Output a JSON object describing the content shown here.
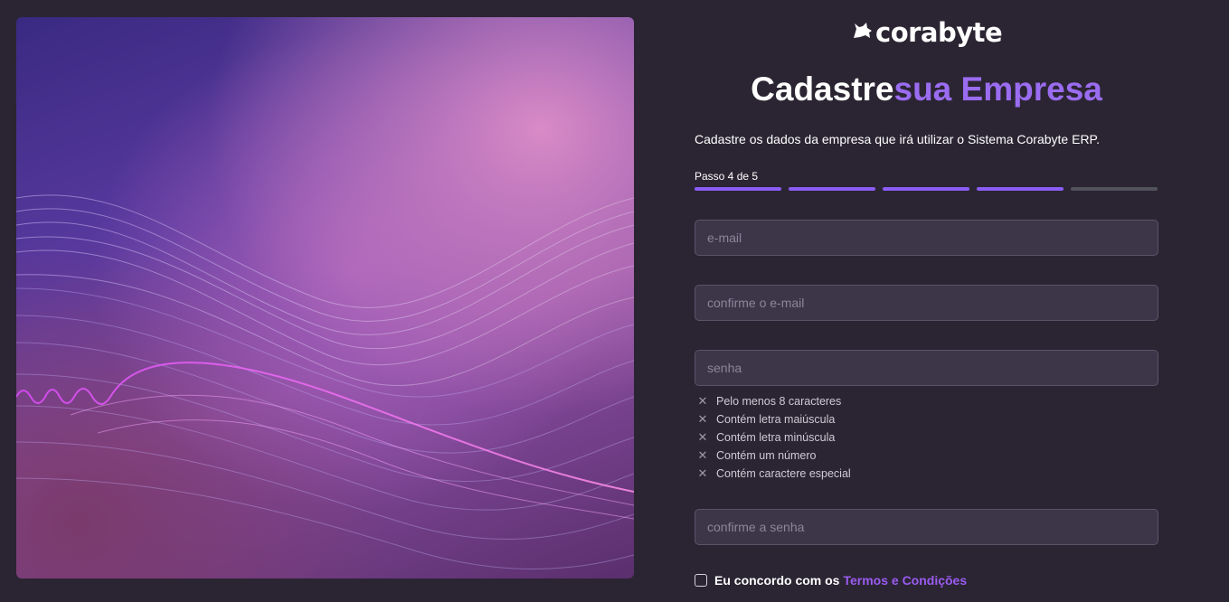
{
  "brand": {
    "name": "corabyte",
    "logo_icon": "wolf-icon"
  },
  "header": {
    "title_part1": "Cadastre",
    "title_part2": "sua Empresa"
  },
  "subtitle": "Cadastre os dados da empresa que irá utilizar o Sistema Corabyte ERP.",
  "progress": {
    "label": "Passo 4 de 5",
    "current": 4,
    "total": 5
  },
  "form": {
    "email_placeholder": "e-mail",
    "confirm_email_placeholder": "confirme o e-mail",
    "password_placeholder": "senha",
    "confirm_password_placeholder": "confirme a senha"
  },
  "password_rules": [
    {
      "label": "Pelo menos 8 caracteres",
      "icon": "x-icon"
    },
    {
      "label": "Contém letra maiúscula",
      "icon": "x-icon"
    },
    {
      "label": "Contém letra minúscula",
      "icon": "x-icon"
    },
    {
      "label": "Contém um número",
      "icon": "x-icon"
    },
    {
      "label": "Contém caractere especial",
      "icon": "x-icon"
    }
  ],
  "terms": {
    "prefix": "Eu concordo com os",
    "link": "Termos e Condições",
    "checked": false
  },
  "colors": {
    "background": "#2b2533",
    "accent": "#8b5cf6",
    "input_bg": "#3d3649"
  }
}
